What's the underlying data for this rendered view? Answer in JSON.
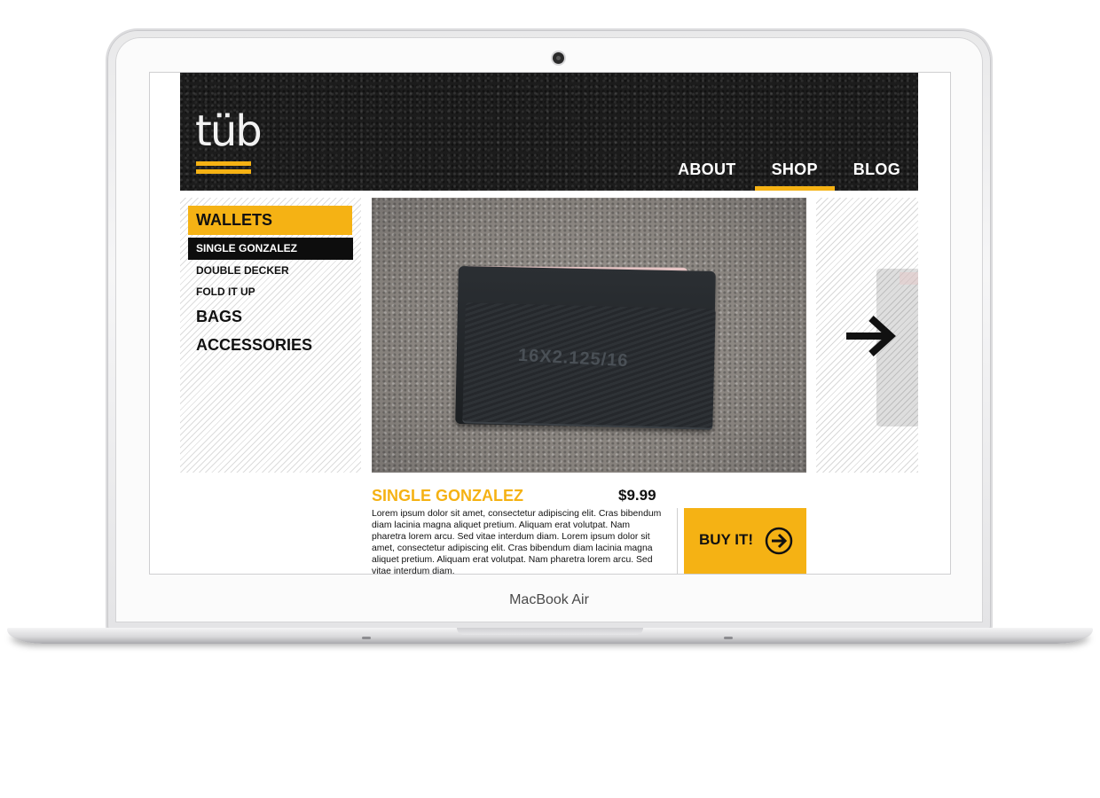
{
  "device": {
    "brand_label": "MacBook Air"
  },
  "site": {
    "logo_text": "tüb",
    "nav": [
      {
        "label": "ABOUT",
        "active": false
      },
      {
        "label": "SHOP",
        "active": true
      },
      {
        "label": "BLOG",
        "active": false
      }
    ],
    "accent_color": "#f5b214"
  },
  "sidebar": {
    "category": "WALLETS",
    "sub_items": [
      {
        "label": "SINGLE GONZALEZ",
        "active": true
      },
      {
        "label": "DOUBLE DECKER",
        "active": false
      },
      {
        "label": "FOLD IT UP",
        "active": false
      }
    ],
    "other_categories": [
      "BAGS",
      "ACCESSORIES"
    ]
  },
  "product": {
    "image_text": "16X2.125/16",
    "name": "SINGLE GONZALEZ",
    "price": "$9.99",
    "description": "Lorem ipsum dolor sit amet, consectetur adipiscing elit. Cras bibendum diam lacinia magna aliquet pretium. Aliquam erat volutpat. Nam pharetra lorem arcu. Sed vitae interdum diam. Lorem ipsum dolor sit amet, consectetur adipiscing elit. Cras bibendum diam lacinia magna aliquet pretium. Aliquam erat volutpat. Nam pharetra lorem arcu. Sed vitae interdum diam.",
    "buy_label": "BUY IT!",
    "next_icon": "arrow-right-icon",
    "buy_icon": "circle-arrow-right-icon"
  }
}
